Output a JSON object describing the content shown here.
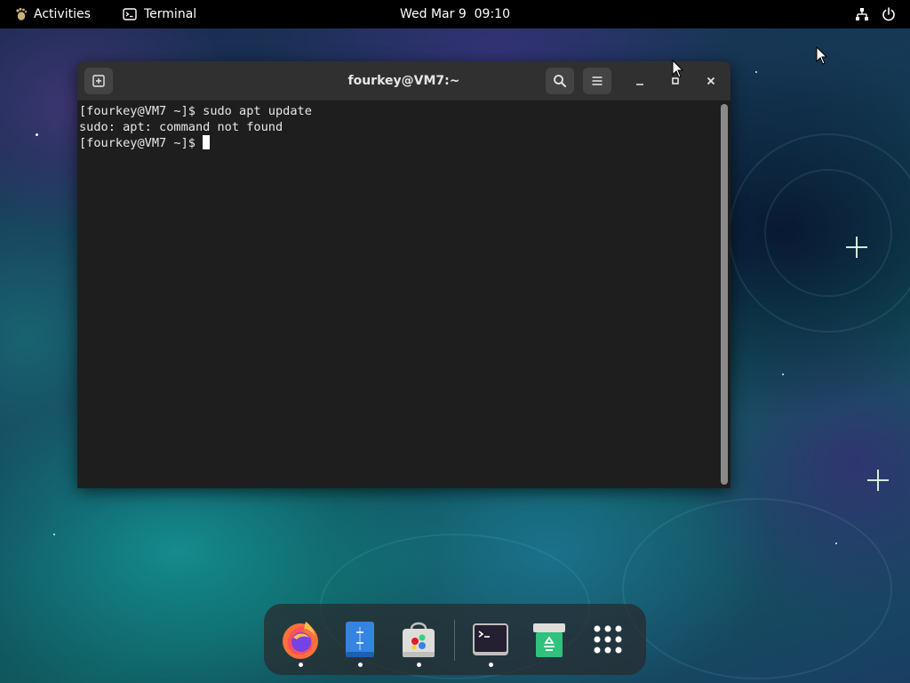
{
  "topbar": {
    "activities_label": "Activities",
    "app_name": "Terminal",
    "clock": "Wed Mar 9  09:10"
  },
  "window": {
    "title": "fourkey@VM7:~"
  },
  "terminal": {
    "lines": [
      "[fourkey@VM7 ~]$ sudo apt update",
      "sudo: apt: command not found",
      "[fourkey@VM7 ~]$ "
    ]
  },
  "dock": {
    "items": [
      {
        "icon": "firefox-icon",
        "running": true
      },
      {
        "icon": "files-icon",
        "running": true
      },
      {
        "icon": "software-icon",
        "running": true
      },
      {
        "icon": "terminal-icon",
        "running": true
      },
      {
        "icon": "trash-icon",
        "running": false
      },
      {
        "icon": "app-grid-icon",
        "running": false
      }
    ]
  },
  "colors": {
    "terminal_bg": "#1e1e1e",
    "headerbar_bg": "#303030",
    "topbar_bg": "#000000",
    "files_blue": "#3584e4",
    "trash_green": "#2ec27e"
  }
}
